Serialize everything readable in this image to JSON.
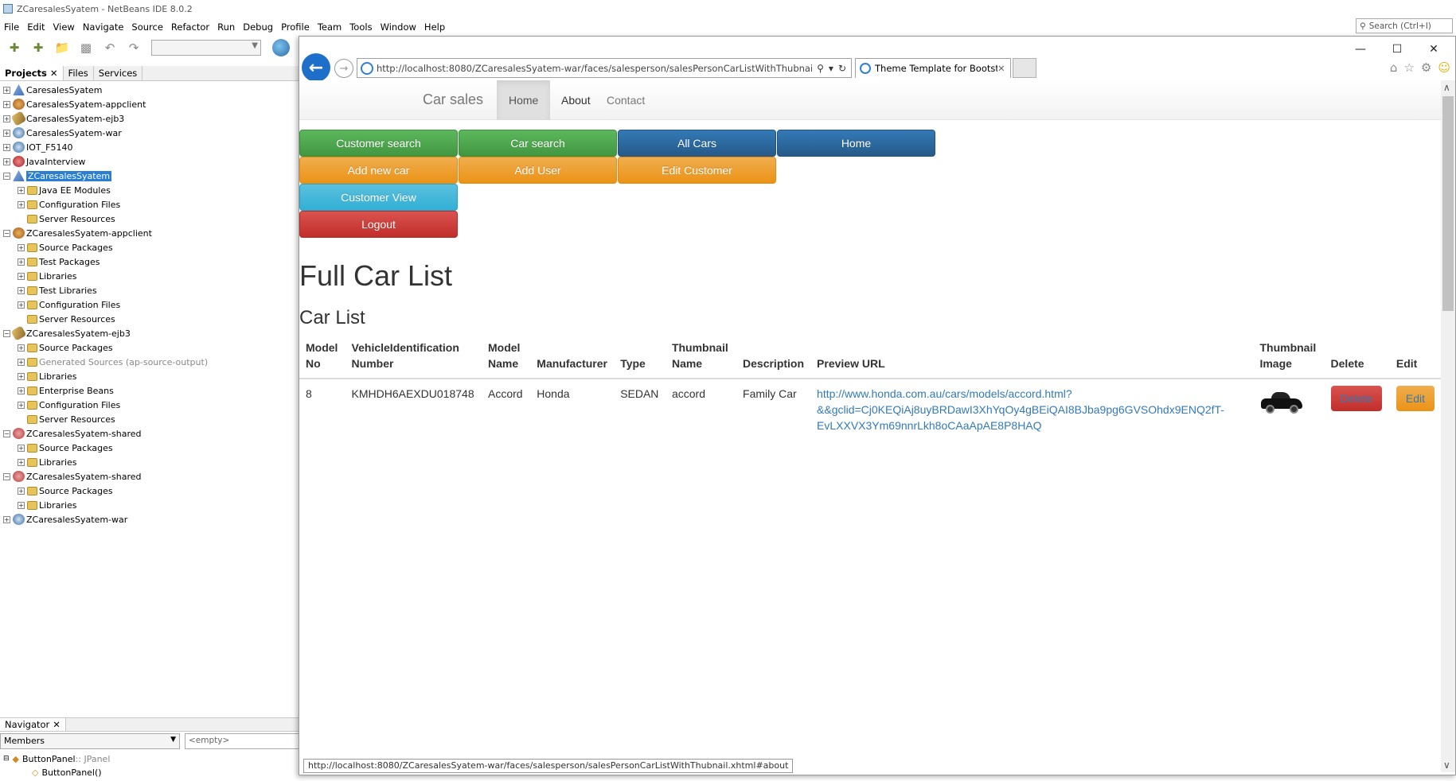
{
  "ide": {
    "title": "ZCaresalesSyatem - NetBeans IDE 8.0.2",
    "menu": [
      "File",
      "Edit",
      "View",
      "Navigate",
      "Source",
      "Refactor",
      "Run",
      "Debug",
      "Profile",
      "Team",
      "Tools",
      "Window",
      "Help"
    ],
    "search_placeholder": "Search (Ctrl+I)",
    "panel_tabs": [
      "Projects",
      "Files",
      "Services"
    ],
    "tree": [
      {
        "label": "CaresalesSyatem",
        "icon": "project-icon",
        "level": 0
      },
      {
        "label": "CaresalesSyatem-appclient",
        "icon": "appclient-icon",
        "level": 0
      },
      {
        "label": "CaresalesSyatem-ejb3",
        "icon": "ejb-icon",
        "level": 0
      },
      {
        "label": "CaresalesSyatem-war",
        "icon": "web-icon",
        "level": 0
      },
      {
        "label": "IOT_F5140",
        "icon": "web-icon",
        "level": 0
      },
      {
        "label": "JavaInterview",
        "icon": "java-icon",
        "level": 0
      },
      {
        "label": "ZCaresalesSyatem",
        "icon": "project-icon",
        "level": 0,
        "selected": true
      },
      {
        "label": "Java EE Modules",
        "icon": "folder-icon",
        "level": 1
      },
      {
        "label": "Configuration Files",
        "icon": "folder-icon",
        "level": 1
      },
      {
        "label": "Server Resources",
        "icon": "folder-icon",
        "level": 1
      },
      {
        "label": "ZCaresalesSyatem-appclient",
        "icon": "appclient-icon",
        "level": 0
      },
      {
        "label": "Source Packages",
        "icon": "folder-icon",
        "level": 1
      },
      {
        "label": "Test Packages",
        "icon": "folder-icon",
        "level": 1
      },
      {
        "label": "Libraries",
        "icon": "folder-icon",
        "level": 1
      },
      {
        "label": "Test Libraries",
        "icon": "folder-icon",
        "level": 1
      },
      {
        "label": "Configuration Files",
        "icon": "folder-icon",
        "level": 1
      },
      {
        "label": "Server Resources",
        "icon": "folder-icon",
        "level": 1
      },
      {
        "label": "ZCaresalesSyatem-ejb3",
        "icon": "ejb-icon",
        "level": 0
      },
      {
        "label": "Source Packages",
        "icon": "folder-icon",
        "level": 1
      },
      {
        "label": "Generated Sources (ap-source-output)",
        "icon": "folder-icon",
        "level": 1,
        "dim": true
      },
      {
        "label": "Libraries",
        "icon": "folder-icon",
        "level": 1
      },
      {
        "label": "Enterprise Beans",
        "icon": "folder-icon",
        "level": 1
      },
      {
        "label": "Configuration Files",
        "icon": "folder-icon",
        "level": 1
      },
      {
        "label": "Server Resources",
        "icon": "folder-icon",
        "level": 1
      },
      {
        "label": "ZCaresalesSyatem-shared",
        "icon": "shared-icon",
        "level": 0
      },
      {
        "label": "Source Packages",
        "icon": "folder-icon",
        "level": 1
      },
      {
        "label": "Libraries",
        "icon": "folder-icon",
        "level": 1
      },
      {
        "label": "ZCaresalesSyatem-shared",
        "icon": "shared-icon",
        "level": 0
      },
      {
        "label": "Source Packages",
        "icon": "folder-icon",
        "level": 1
      },
      {
        "label": "Libraries",
        "icon": "folder-icon",
        "level": 1
      },
      {
        "label": "ZCaresalesSyatem-war",
        "icon": "web-icon",
        "level": 0
      }
    ],
    "navigator": {
      "tab": "Navigator",
      "members": "Members",
      "filter": "<empty>",
      "rows": [
        {
          "name": "ButtonPanel",
          "type": " :: JPanel"
        },
        {
          "name": "ButtonPanel()",
          "type": ""
        }
      ]
    }
  },
  "browser": {
    "url": "http://localhost:8080/ZCaresalesSyatem-war/faces/salesperson/salesPersonCarListWithThubnail.xhtm",
    "tab_title": "Theme Template for Bootst...",
    "status_url": "http://localhost:8080/ZCaresalesSyatem-war/faces/salesperson/salesPersonCarListWithThubnail.xhtml#about"
  },
  "page": {
    "brand": "Car sales",
    "nav": {
      "home": "Home",
      "about": "About",
      "contact": "Contact"
    },
    "buttons": {
      "customer_search": "Customer search",
      "car_search": "Car search",
      "all_cars": "All Cars",
      "home": "Home",
      "add_new_car": "Add new car",
      "add_user": "Add User",
      "edit_customer": "Edit Customer",
      "customer_view": "Customer View",
      "logout": "Logout"
    },
    "heading": "Full Car List",
    "subheading": "Car List",
    "table": {
      "headers": {
        "model_no": "Model No",
        "vin": "VehicleIdentification Number",
        "model_name": "Model Name",
        "manufacturer": "Manufacturer",
        "type": "Type",
        "thumb_name": "Thumbnail Name",
        "description": "Description",
        "preview_url": "Preview URL",
        "thumb_image": "Thumbnail Image",
        "delete": "Delete",
        "edit": "Edit"
      },
      "rows": [
        {
          "model_no": "8",
          "vin": "KMHDH6AEXDU018748",
          "model_name": "Accord",
          "manufacturer": "Honda",
          "type": "SEDAN",
          "thumb_name": "accord",
          "description": "Family Car",
          "preview_url_1": "http://www.honda.com.au/cars/models/accord.html?",
          "preview_url_2": "&&gclid=Cj0KEQiAj8uyBRDawI3XhYqOy4gBEiQAI8BJba9pg6GVSOhdx9ENQ2fT-",
          "preview_url_3": "EvLXXVX3Ym69nnrLkh8oCAaApAE8P8HAQ",
          "delete_label": "Delete",
          "edit_label": "Edit"
        }
      ]
    }
  }
}
